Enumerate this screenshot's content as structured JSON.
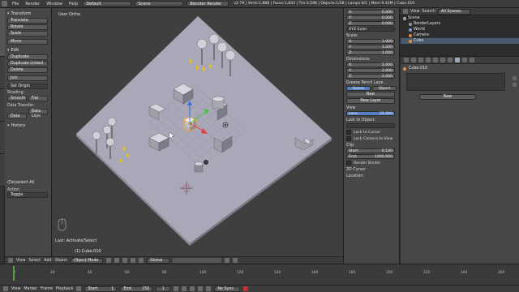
{
  "topbar": {
    "menus": [
      "File",
      "Render",
      "Window",
      "Help"
    ],
    "screen_layout": "Default",
    "scene": "Scene",
    "engine": "Blender Render",
    "stats": "v2.79 | Verts:1,888 | Faces:1,843 | Tris:3,596 | Objects:1/28 | Lamps:0/1 | Mem:9.42M | Cube.010"
  },
  "toolshelf": {
    "transform_header": "Transform",
    "translate": "Translate",
    "rotate": "Rotate",
    "scale": "Scale",
    "mirror": "Mirror",
    "edit_header": "Edit",
    "duplicate": "Duplicate",
    "duplicate_linked": "Duplicate Linked",
    "delete": "Delete",
    "join": "Join",
    "set_origin": "Set Origin",
    "shading_label": "Shading:",
    "smooth": "Smooth",
    "flat": "Flat",
    "data_transfer_label": "Data Transfer:",
    "data": "Data",
    "data_layout": "Data Layo",
    "history_header": "History"
  },
  "operator": {
    "header": "(De)select All",
    "action_label": "Action",
    "action_value": "Toggle"
  },
  "viewport": {
    "title": "User Ortho",
    "object_label": "(1) Cube.010",
    "last_op": "Last: Activate/Select"
  },
  "vpheader": {
    "view": "View",
    "select": "Select",
    "add": "Add",
    "object": "Object",
    "mode": "Object Mode",
    "orientation": "Global"
  },
  "npanel": {
    "loc_x": "X:",
    "loc_x_val": "0.000",
    "loc_y": "Y:",
    "loc_y_val": "0.000",
    "loc_z": "Z:",
    "loc_z_val": "0.000",
    "rotation_mode": "XYZ Euler",
    "scale_label": "Scale:",
    "sx": "X:",
    "sx_val": "1.000",
    "sy": "Y:",
    "sy_val": "1.000",
    "sz": "Z:",
    "sz_val": "1.000",
    "dimensions_label": "Dimensions:",
    "dx": "X:",
    "dx_val": "2.000",
    "dy": "Y:",
    "dy_val": "2.000",
    "dz": "Z:",
    "dz_val": "2.000",
    "grease_header": "Grease Pencil Laye...",
    "scene_tab": "Scene",
    "object_tab": "Object",
    "new_btn": "New",
    "new_layer": "New Layer",
    "view_header": "View",
    "lens_label": "Lens:",
    "lens_val": "35.000",
    "lock_label": "Lock to Object:",
    "lock_cursor": "Lock to Cursor",
    "lock_camera": "Lock Camera to View",
    "clip_label": "Clip:",
    "start_label": "Start:",
    "start_val": "0.100",
    "end_label": "End:",
    "end_val": "1000.000",
    "render_border": "Render Border",
    "cursor_header": "3D Cursor",
    "location_label": "Location:"
  },
  "outliner": {
    "view": "View",
    "search": "Search",
    "all_scenes": "All Scenes",
    "rows": [
      "Scene",
      "RenderLayers",
      "World",
      "Camera",
      "Cube"
    ]
  },
  "props": {
    "object_name": "Cube.010",
    "new_btn": "New"
  },
  "timeline": {
    "view": "View",
    "marker": "Marker",
    "frame": "Frame",
    "playback": "Playback",
    "start_label": "Start:",
    "start_val": "1",
    "end_label": "End:",
    "end_val": "250",
    "current": "1",
    "sync": "No Sync",
    "ruler_labels": [
      "0",
      "20",
      "40",
      "60",
      "80",
      "100",
      "120",
      "140",
      "160",
      "180",
      "200",
      "220",
      "240",
      "260"
    ]
  },
  "colors": {
    "accent": "#5680c2",
    "panel": "#474747",
    "viewport_bg": "#3f3f3f",
    "plane": "#a8a8b8",
    "selected_object": "#f0a030"
  }
}
